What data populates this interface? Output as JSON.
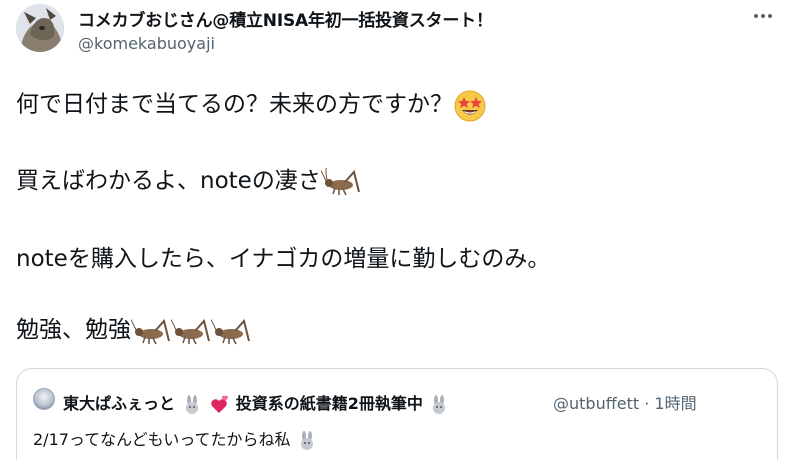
{
  "author": {
    "display_name": "コメカブおじさん@積立NISA年初一括投資スタート！",
    "handle": "@komekabuoyaji"
  },
  "tweet": {
    "line1": "何で日付まで当てるの？未来の方ですか？",
    "line2": "買えばわかるよ、noteの凄さ",
    "line3": "noteを購入したら、イナゴカの増量に勤しむのみ。",
    "line4": "勉強、勉強"
  },
  "icons": {
    "menu": "more-horizontal-icon",
    "emoji_star_eyes": "star-struck-emoji",
    "emoji_cricket": "cricket-emoji",
    "emoji_rabbit": "rabbit-emoji",
    "emoji_heart": "two-hearts-emoji"
  },
  "quoted_tweet": {
    "name_part1": "東大ぱふぇっと",
    "name_part2": "投資系の紙書籍2冊執筆中",
    "meta": "@utbuffett · 1時間",
    "text": "2/17ってなんどもいってたからね私"
  },
  "colors": {
    "text": "#0f1419",
    "secondary": "#536471",
    "border": "#cfd9de"
  }
}
